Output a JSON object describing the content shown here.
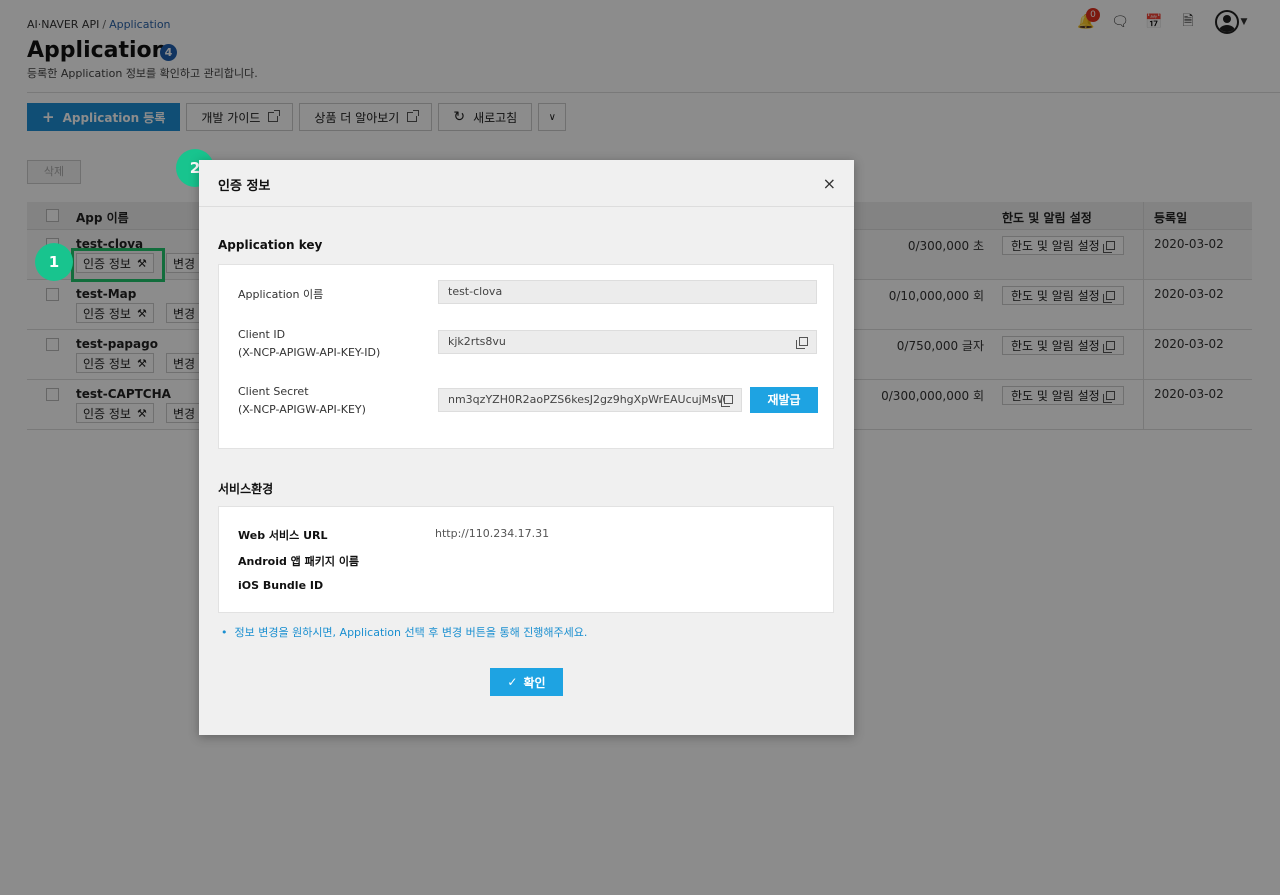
{
  "breadcrumb": {
    "root": "AI·NAVER API",
    "separator": "/",
    "current": "Application"
  },
  "page": {
    "title": "Application",
    "count": "4",
    "description": "등록한 Application 정보를 확인하고 관리합니다."
  },
  "header_icons": {
    "notification_count": "0"
  },
  "toolbar": {
    "register": "Application 등록",
    "dev_guide": "개발 가이드",
    "learn_more": "상품 더 알아보기",
    "refresh": "새로고침"
  },
  "delete_label": "삭제",
  "table": {
    "columns": {
      "app_name": "App 이름",
      "limit": "한도 및 알림 설정",
      "registered": "등록일"
    },
    "auth_label": "인증 정보",
    "edit_label": "변경",
    "limit_label": "한도 및 알림 설정",
    "rows": [
      {
        "name": "test-clova",
        "quota": "0/300,000 초",
        "date": "2020-03-02"
      },
      {
        "name": "test-Map",
        "quota": "0/10,000,000 회",
        "date": "2020-03-02"
      },
      {
        "name": "test-papago",
        "quota": "0/750,000 글자",
        "date": "2020-03-02"
      },
      {
        "name": "test-CAPTCHA",
        "quota": "0/300,000,000 회",
        "date": "2020-03-02"
      }
    ]
  },
  "markers": {
    "one": "1",
    "two": "2"
  },
  "modal": {
    "title": "인증 정보",
    "close": "×",
    "app_key_section": "Application key",
    "fields": {
      "app_name_label": "Application 이름",
      "app_name_value": "test-clova",
      "client_id_label": "Client ID",
      "client_id_sub": "(X-NCP-APIGW-API-KEY-ID)",
      "client_id_value": "kjk2rts8vu",
      "client_secret_label": "Client Secret",
      "client_secret_sub": "(X-NCP-APIGW-API-KEY)",
      "client_secret_value": "nm3qzYZH0R2aoPZS6kesJ2gz9hgXpWrEAUcujMsW",
      "reissue": "재발급"
    },
    "service_section": "서비스환경",
    "service": {
      "web_label": "Web 서비스 URL",
      "web_value": "http://110.234.17.31",
      "android_label": "Android 앱 패키지 이름",
      "ios_label": "iOS Bundle ID"
    },
    "note": "정보 변경을 원하시면, Application 선택 후 변경 버튼을 통해 진행해주세요.",
    "confirm": "확인"
  },
  "colors": {
    "primary": "#1ea3e2",
    "marker": "#18c48e",
    "highlight": "#22c76e",
    "badge": "#1f5fb0"
  }
}
